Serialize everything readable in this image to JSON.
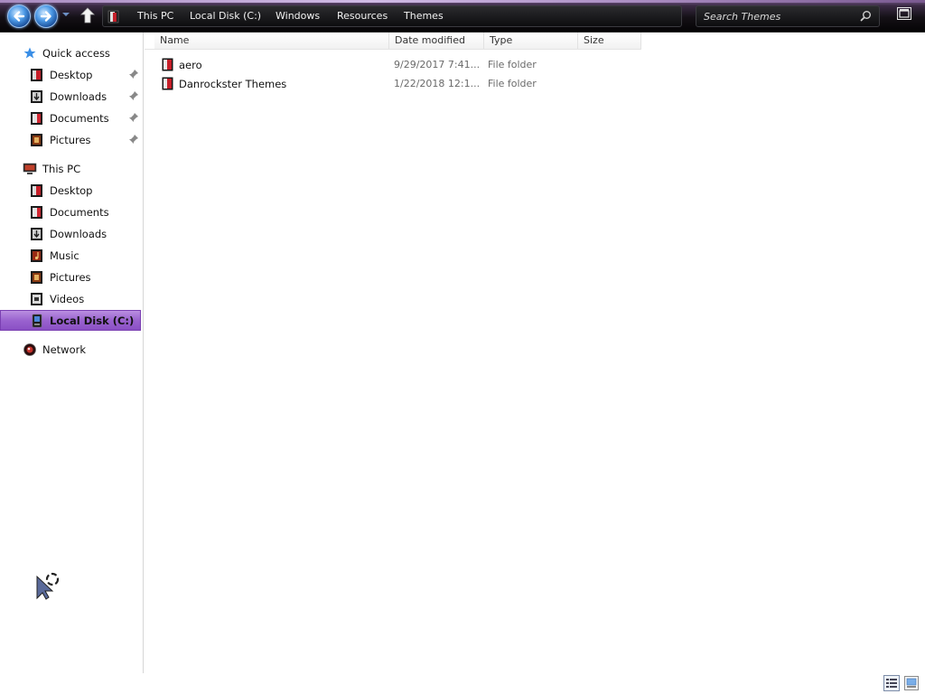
{
  "toolbar": {
    "breadcrumbs": [
      "This PC",
      "Local Disk (C:)",
      "Windows",
      "Resources",
      "Themes"
    ],
    "search_placeholder": "Search Themes"
  },
  "sidebar": {
    "quick_access": {
      "label": "Quick access",
      "items": [
        {
          "label": "Desktop",
          "pinned": true
        },
        {
          "label": "Downloads",
          "pinned": true
        },
        {
          "label": "Documents",
          "pinned": true
        },
        {
          "label": "Pictures",
          "pinned": true
        }
      ]
    },
    "this_pc": {
      "label": "This PC",
      "items": [
        {
          "label": "Desktop"
        },
        {
          "label": "Documents"
        },
        {
          "label": "Downloads"
        },
        {
          "label": "Music"
        },
        {
          "label": "Pictures"
        },
        {
          "label": "Videos"
        },
        {
          "label": "Local Disk (C:)",
          "selected": true
        }
      ]
    },
    "network": {
      "label": "Network"
    }
  },
  "content": {
    "columns": [
      "Name",
      "Date modified",
      "Type",
      "Size"
    ],
    "rows": [
      {
        "name": "aero",
        "date": "9/29/2017 7:41...",
        "type": "File folder",
        "size": ""
      },
      {
        "name": "Danrockster Themes",
        "date": "1/22/2018 12:1...",
        "type": "File folder",
        "size": ""
      }
    ]
  },
  "colors": {
    "selected_bg": "#9a63cf",
    "topbar_bg": "#141016",
    "nav_button": "#4d9ae6"
  },
  "icons": {
    "back": "back-arrow-icon",
    "forward": "forward-arrow-icon",
    "up": "up-arrow-icon",
    "search": "search-icon",
    "folder": "folder-icon",
    "pin": "pin-icon"
  }
}
